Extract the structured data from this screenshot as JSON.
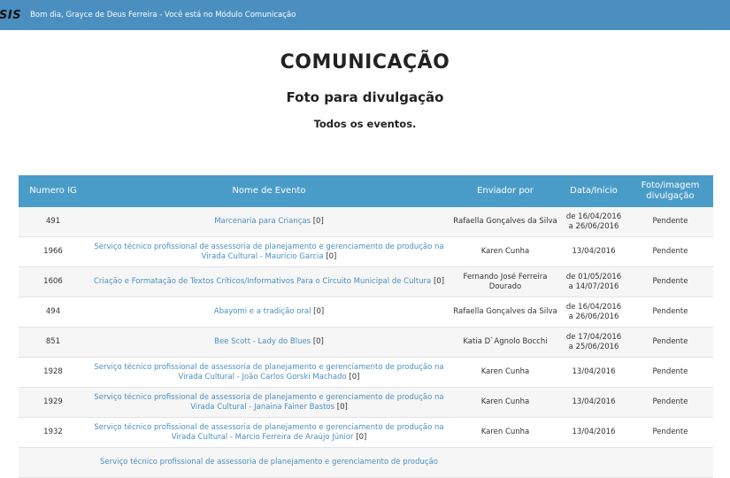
{
  "topbar": {
    "logo": "SIS",
    "greeting": "Bom dia, Grayce de Deus Ferreira - Você está no Módulo Comunicação"
  },
  "page": {
    "title": "COMUNICAÇÃO",
    "subtitle": "Foto para divulgação",
    "filter": "Todos os eventos."
  },
  "table": {
    "headers": [
      "Numero IG",
      "Nome de Evento",
      "Enviador por",
      "Data/Início",
      "Foto/imagem divulgação"
    ],
    "rows": [
      {
        "ig": "491",
        "event": "Marcenaria para Crianças",
        "count": "[0]",
        "sender": "Rafaella Gonçalves da Silva",
        "date": "de 16/04/2016 a 26/06/2016",
        "status": "Pendente"
      },
      {
        "ig": "1966",
        "event": "Serviço técnico profissional de assessoria de planejamento e gerenciamento de produção na Virada Cultural - Mauricio Garcia",
        "count": "[0]",
        "sender": "Karen Cunha",
        "date": "13/04/2016",
        "status": "Pendente"
      },
      {
        "ig": "1606",
        "event": "Criação e Formatação de Textos Críticos/Informativos Para o Circuito Municipal de Cultura",
        "count": "[0]",
        "sender": "Fernando José Ferreira Dourado",
        "date": "de 01/05/2016 a 14/07/2016",
        "status": "Pendente"
      },
      {
        "ig": "494",
        "event": "Abayomi e a tradição oral",
        "count": "[0]",
        "sender": "Rafaella Gonçalves da Silva",
        "date": "de 16/04/2016 a 26/06/2016",
        "status": "Pendente"
      },
      {
        "ig": "851",
        "event": "Bee Scott - Lady do Blues",
        "count": "[0]",
        "sender": "Katia D`Agnolo Bocchi",
        "date": "de 17/04/2016 a 25/06/2016",
        "status": "Pendente"
      },
      {
        "ig": "1928",
        "event": "Serviço técnico profissional de assessoria de planejamento e gerenciamento de produção na Virada Cultural - João Carlos Gorski Machado",
        "count": "[0]",
        "sender": "Karen Cunha",
        "date": "13/04/2016",
        "status": "Pendente"
      },
      {
        "ig": "1929",
        "event": "Serviço técnico profissional de assessoria de planejamento e gerenciamento de produção na Virada Cultural - Janaina Fainer Bastos",
        "count": "[0]",
        "sender": "Karen Cunha",
        "date": "13/04/2016",
        "status": "Pendente"
      },
      {
        "ig": "1932",
        "event": "Serviço técnico profissional de assessoria de planejamento e gerenciamento de produção na Virada Cultural - Marcio Ferreira de Araújo Júnior",
        "count": "[0]",
        "sender": "Karen Cunha",
        "date": "13/04/2016",
        "status": "Pendente"
      },
      {
        "ig": "",
        "event": "Serviço técnico profissional de assessoria de planejamento e gerenciamento de produção",
        "count": "",
        "sender": "",
        "date": "",
        "status": ""
      }
    ]
  }
}
